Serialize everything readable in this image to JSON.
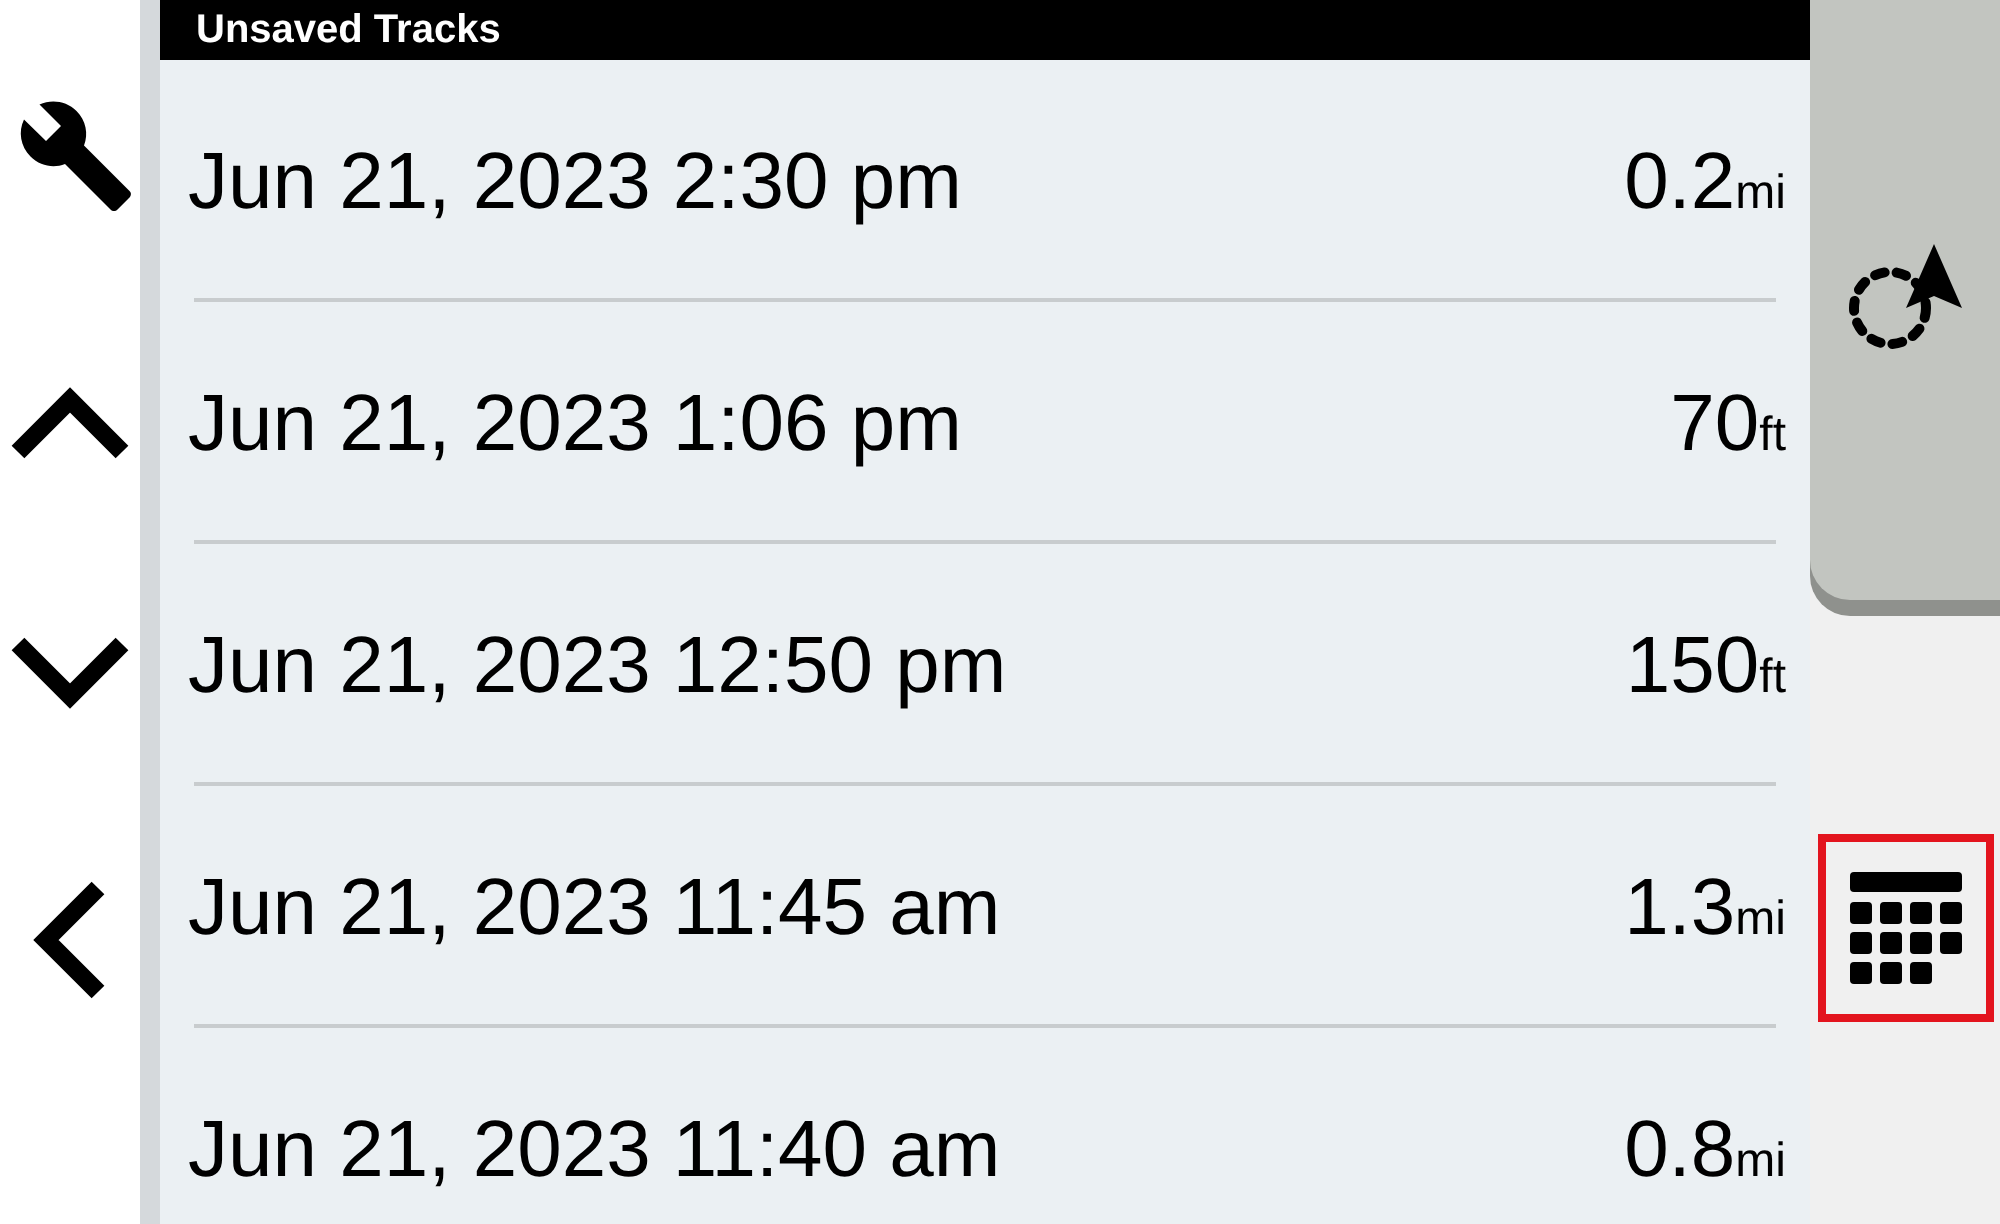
{
  "header": {
    "title": "Unsaved Tracks"
  },
  "tracks": [
    {
      "date": "Jun 21, 2023 2:30 pm",
      "distance": "0.2",
      "unit": "mi"
    },
    {
      "date": "Jun 21, 2023 1:06 pm",
      "distance": "70",
      "unit": "ft"
    },
    {
      "date": "Jun 21, 2023 12:50 pm",
      "distance": "150",
      "unit": "ft"
    },
    {
      "date": "Jun 21, 2023 11:45 am",
      "distance": "1.3",
      "unit": "mi"
    },
    {
      "date": "Jun 21, 2023 11:40 am",
      "distance": "0.8",
      "unit": "mi"
    }
  ],
  "calendar_button": {
    "highlighted": true
  }
}
